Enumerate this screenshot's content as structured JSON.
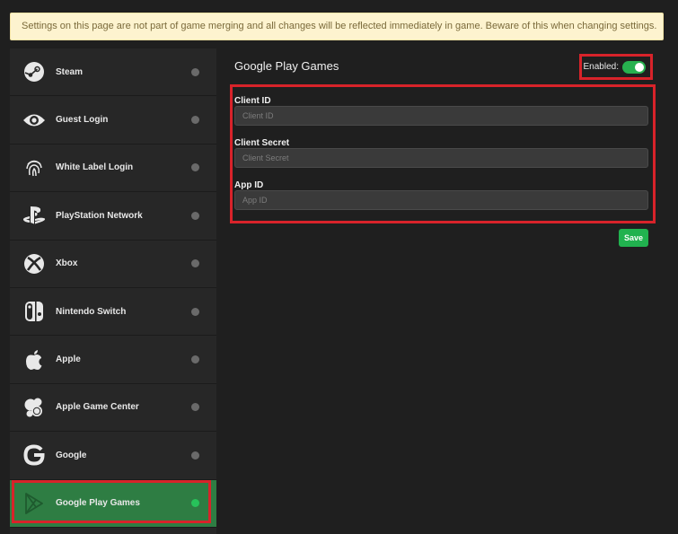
{
  "banner": {
    "text": "Settings on this page are not part of game merging and all changes will be reflected immediately in game. Beware of this when changing settings."
  },
  "sidebar": {
    "items": [
      {
        "label": "Steam",
        "icon": "steam-icon",
        "enabled": false
      },
      {
        "label": "Guest Login",
        "icon": "eye-icon",
        "enabled": false
      },
      {
        "label": "White Label Login",
        "icon": "fingerprint-icon",
        "enabled": false
      },
      {
        "label": "PlayStation Network",
        "icon": "playstation-icon",
        "enabled": false
      },
      {
        "label": "Xbox",
        "icon": "xbox-icon",
        "enabled": false
      },
      {
        "label": "Nintendo Switch",
        "icon": "nintendo-switch-icon",
        "enabled": false
      },
      {
        "label": "Apple",
        "icon": "apple-icon",
        "enabled": false
      },
      {
        "label": "Apple Game Center",
        "icon": "game-center-icon",
        "enabled": false
      },
      {
        "label": "Google",
        "icon": "google-icon",
        "enabled": false
      },
      {
        "label": "Google Play Games",
        "icon": "google-play-icon",
        "enabled": true,
        "active": true
      }
    ]
  },
  "panel": {
    "title": "Google Play Games",
    "enabled_label": "Enabled:",
    "enabled": true,
    "fields": [
      {
        "label": "Client ID",
        "placeholder": "Client ID",
        "value": ""
      },
      {
        "label": "Client Secret",
        "placeholder": "Client Secret",
        "value": ""
      },
      {
        "label": "App ID",
        "placeholder": "App ID",
        "value": ""
      }
    ],
    "save_label": "Save"
  },
  "colors": {
    "accent_green": "#21b24f",
    "active_item_bg": "#2e7d43",
    "highlight_red": "#d8232a",
    "banner_bg": "#fdf3cf"
  }
}
